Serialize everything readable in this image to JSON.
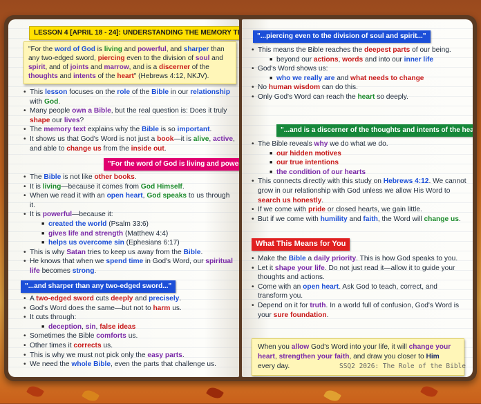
{
  "title": "LESSON 4 [APRIL 18 - 24]: UNDERSTANDING THE MEMORY TEXT",
  "verse": {
    "q": "\"For the ",
    "w1": "word of God",
    "t1": " is ",
    "w2": "living",
    "t2": " and ",
    "w3": "powerful",
    "t3": ", and ",
    "w4": "sharper",
    "t4": " than any two-edged sword, ",
    "w5": "piercing",
    "t5": " even to the division of ",
    "w6": "soul",
    "t6": " and ",
    "w7": "spirit",
    "t7": ", and of ",
    "w8": "joints",
    "t8": " and ",
    "w9": "marrow",
    "t9": ", and is a ",
    "w10": "discerner",
    "t10": " of the ",
    "w11": "thoughts",
    "t11": " and ",
    "w12": "intents",
    "t12": " of the ",
    "w13": "heart",
    "t13": "\" (Hebrews 4:12, NKJV)."
  },
  "left": {
    "intro": {
      "i1a": "This ",
      "i1b": "lesson",
      "i1c": " focuses on the ",
      "i1d": "role",
      "i1e": " of the ",
      "i1f": "Bible",
      "i1g": " in our ",
      "i1h": "relationship",
      "i1i": " with ",
      "i1j": "God",
      "i1k": ".",
      "i2a": "Many people ",
      "i2b": "own a Bible",
      "i2c": ", but the real question is: Does it truly ",
      "i2d": "shape",
      "i2e": " our ",
      "i2f": "lives",
      "i2g": "?",
      "i3a": "The ",
      "i3b": "memory text",
      "i3c": " explains why the ",
      "i3d": "Bible",
      "i3e": " is so ",
      "i3f": "important",
      "i3g": ".",
      "i4a": "It shows us that God's Word is not just a ",
      "i4b": "book",
      "i4c": "—it is ",
      "i4d": "alive",
      "i4e": ", ",
      "i4f": "active",
      "i4g": ", and able to ",
      "i4h": "change us",
      "i4i": " from the ",
      "i4j": "inside out",
      "i4k": "."
    },
    "tag1": "\"For the word of God is living and powerful...\"",
    "s1": {
      "a1": "The ",
      "a2": "Bible",
      "a3": " is not like ",
      "a4": "other books",
      "a5": ".",
      "b1": "It is ",
      "b2": "living",
      "b3": "—because it comes from ",
      "b4": "God Himself",
      "b5": ".",
      "c1": "When we read it with an ",
      "c2": "open heart",
      "c3": ", ",
      "c4": "God speaks",
      "c5": " to us through it.",
      "d1": "It is ",
      "d2": "powerful",
      "d3": "—because it:",
      "e1": "created the world",
      "e2": " (Psalm 33:6)",
      "f1": "gives life and strength",
      "f2": " (Matthew 4:4)",
      "g1": "helps us overcome sin",
      "g2": " (Ephesians 6:17)",
      "h1": "This is why ",
      "h2": "Satan",
      "h3": " tries to keep us away from the ",
      "h4": "Bible",
      "h5": ".",
      "j1": "He knows that when we ",
      "j2": "spend time",
      "j3": " in God's Word, our ",
      "j4": "spiritual life",
      "j5": " becomes ",
      "j6": "strong",
      "j7": "."
    },
    "tag2": "\"...and sharper than any two-edged sword...\"",
    "s2": {
      "a1": "A ",
      "a2": "two-edged sword",
      "a3": " cuts ",
      "a4": "deeply",
      "a5": " and ",
      "a6": "precisely",
      "a7": ".",
      "b1": "God's Word does the same—but not to ",
      "b2": "harm",
      "b3": " us.",
      "c1": "It cuts through:",
      "d1": "deception",
      "d2": ", ",
      "d3": "sin",
      "d4": ", ",
      "d5": "false ideas",
      "e1": "Sometimes the Bible ",
      "e2": "comforts",
      "e3": " us.",
      "f1": "Other times it ",
      "f2": "corrects",
      "f3": " us.",
      "g1": "This is why we must not pick only the ",
      "g2": "easy parts",
      "g3": ".",
      "h1": "We need the ",
      "h2": "whole Bible",
      "h3": ", even the parts that challenge us."
    }
  },
  "right": {
    "tag3": "\"...piercing even to the division of soul and spirit...\"",
    "s3": {
      "a1": "This means the Bible reaches the ",
      "a2": "deepest parts",
      "a3": " of our being.",
      "b1": "beyond our ",
      "b2": "actions",
      "b3": ", ",
      "b4": "words",
      "b5": " and into our ",
      "b6": "inner life",
      "c1": "God's Word shows us:",
      "d1": "who we really are",
      "d2": " and ",
      "d3": "what needs to change",
      "e1": "No ",
      "e2": "human wisdom",
      "e3": " can do this.",
      "f1": "Only God's Word can reach the ",
      "f2": "heart",
      "f3": " so deeply."
    },
    "tag4": "\"...and is a discerner of the thoughts and intents of the heart.\"",
    "s4": {
      "a1": "The Bible reveals ",
      "a2": "why",
      "a3": " we do what we do.",
      "b1": "our hidden motives",
      "c1": "our true intentions",
      "d1": "the condition of our hearts",
      "e1": "This connects directly with this study on ",
      "e2": "Hebrews 4:12",
      "e3": ". We cannot grow in our relationship with God unless we allow His Word to ",
      "e4": "search us honestly",
      "e5": ".",
      "f1": "If we come with ",
      "f2": "pride",
      "f3": " or closed hearts, we gain little.",
      "g1": "But if we come with ",
      "g2": "humility",
      "g3": " and ",
      "g4": "faith",
      "g5": ", the Word will ",
      "g6": "change us",
      "g7": "."
    },
    "tag5": "What This Means for You",
    "s5": {
      "a1": "Make the ",
      "a2": "Bible",
      "a3": " a ",
      "a4": "daily priority",
      "a5": ". This is how God speaks to you.",
      "b1": "Let it ",
      "b2": "shape your life",
      "b3": ". Do not just read it—allow it to guide your thoughts and actions.",
      "c1": "Come with an ",
      "c2": "open heart",
      "c3": ". Ask God to teach, correct, and transform you.",
      "d1": "Depend on it for ",
      "d2": "truth",
      "d3": ". In a world full of confusion, God's Word is your ",
      "d4": "sure foundation",
      "d5": "."
    },
    "note": {
      "a1": "When you ",
      "a2": "allow",
      "a3": " God's Word into your life, it will ",
      "a4": "change your heart",
      "a5": ", ",
      "a6": "strengthen your faith",
      "a7": ", and draw you closer to ",
      "a8": "Him",
      "a9": " every day."
    },
    "footer": "SSQ2 2026: The Role of the Bible"
  },
  "colors": {
    "pink": "#e0006e",
    "blue": "#1c4fd8",
    "green": "#16883a",
    "red": "#e02020",
    "yellow": "#ffe000"
  }
}
